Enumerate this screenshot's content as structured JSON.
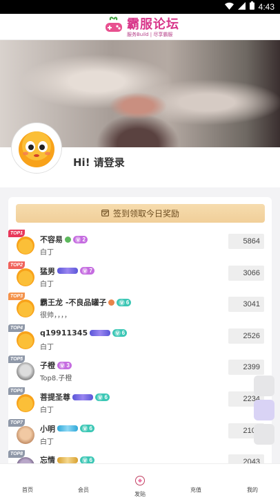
{
  "status_bar": {
    "time": "4:43"
  },
  "header": {
    "logo_title": "霸服论坛",
    "logo_subtitle": "服务Build | 尽享霸服"
  },
  "profile": {
    "greeting": "Hi!  请登录"
  },
  "signin": {
    "label": "签到领取今日奖励"
  },
  "colors": {
    "accent": "#d8368a",
    "signin_bg": "#f1cf99",
    "level_purple": "#c56ce0",
    "level_teal": "#3cc7b5"
  },
  "ranking": [
    {
      "rank": "TOP1",
      "name": "不容易",
      "desc": "白丁",
      "score": "5864",
      "level": "2",
      "level_color": "purple",
      "extra": "dot-green"
    },
    {
      "rank": "TOP2",
      "name": "猛男",
      "desc": "白丁",
      "score": "3066",
      "level": "7",
      "level_color": "purple",
      "extra": "wing"
    },
    {
      "rank": "TOP3",
      "name": "霸王龙 -不良品罐子",
      "desc": "很帅，，，，",
      "score": "3041",
      "level": "6",
      "level_color": "teal",
      "extra": "dot-orange"
    },
    {
      "rank": "TOP4",
      "name": "q19911345",
      "desc": "白丁",
      "score": "2526",
      "level": "6",
      "level_color": "teal",
      "extra": "wing"
    },
    {
      "rank": "TOP5",
      "name": "子橙",
      "desc": "Top8.子橙",
      "score": "2399",
      "level": "3",
      "level_color": "purple",
      "extra": ""
    },
    {
      "rank": "TOP6",
      "name": "菩提圣尊",
      "desc": "白丁",
      "score": "2234",
      "level": "6",
      "level_color": "teal",
      "extra": "wing"
    },
    {
      "rank": "TOP7",
      "name": "小明",
      "desc": "白丁",
      "score": "2102",
      "level": "6",
      "level_color": "teal",
      "extra": "wing-blue"
    },
    {
      "rank": "TOP8",
      "name": "忘情",
      "desc": "",
      "score": "2043",
      "level": "6",
      "level_color": "teal",
      "extra": "wing-gold"
    }
  ],
  "tabs": [
    {
      "label": "首页",
      "icon": "home-icon"
    },
    {
      "label": "会员",
      "icon": "member-icon"
    },
    {
      "label": "发贴",
      "icon": "post-icon"
    },
    {
      "label": "充值",
      "icon": "recharge-icon"
    },
    {
      "label": "我的",
      "icon": "profile-icon"
    }
  ]
}
